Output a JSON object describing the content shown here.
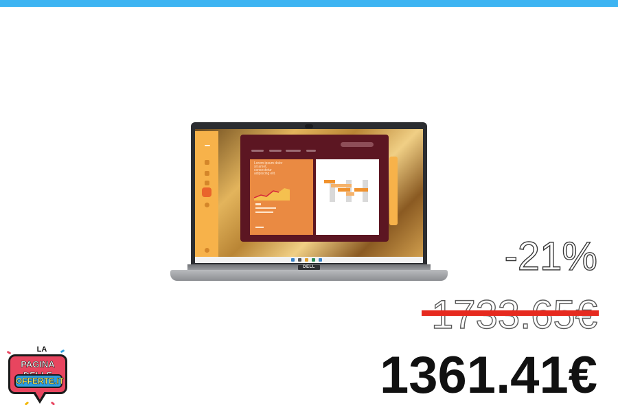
{
  "offer": {
    "discount": "-21%",
    "old_price": "1733.65€",
    "new_price": "1361.41€"
  },
  "product": {
    "screen_text": "Lorem ipsum dolor sit amet, consectetur adipiscing elit.",
    "logo": "DELL"
  },
  "brand": {
    "top": "LA",
    "line1": "PAGINA DELLE",
    "line2": "OFFERTE.IT"
  },
  "colors": {
    "accent_bar": "#3db4f2",
    "strike": "#e62a1f",
    "price": "#111111"
  }
}
